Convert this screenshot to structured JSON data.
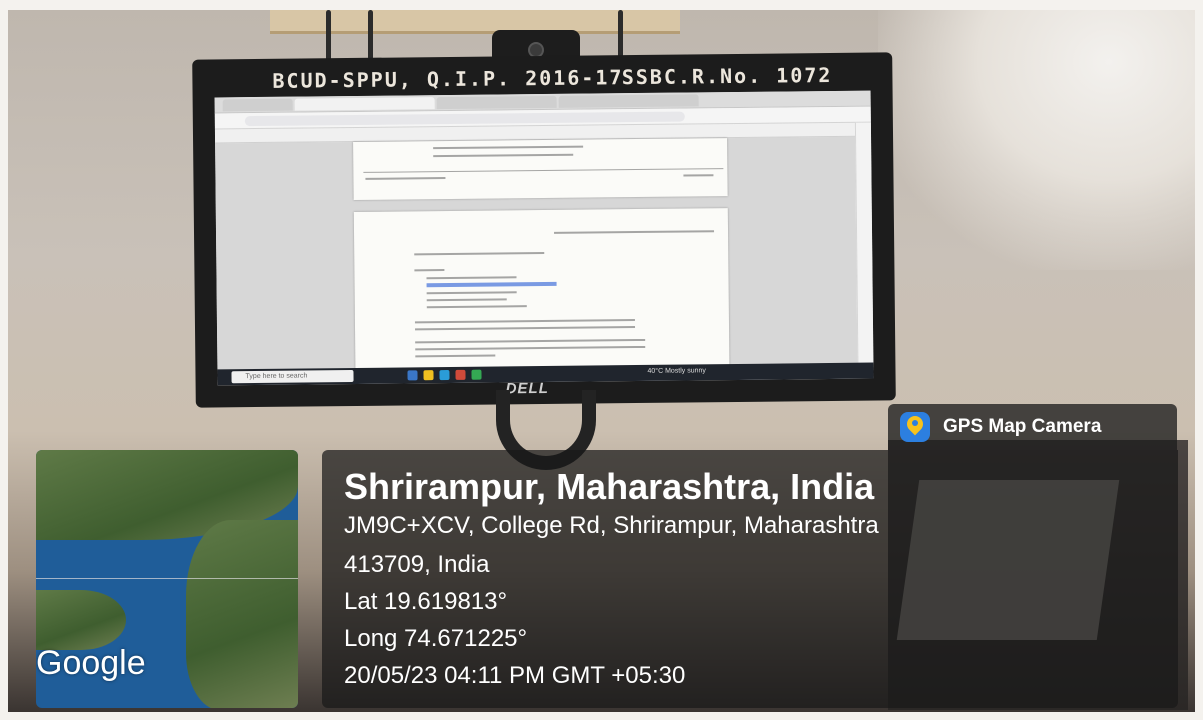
{
  "photo": {
    "monitor_sticker_left": "BCUD-SPPU, Q.I.P. 2016-17",
    "monitor_sticker_right": "SSBC.R.No. 1072",
    "monitor_brand": "DELL"
  },
  "overlay": {
    "app_badge": "GPS Map Camera",
    "location_title": "Shrirampur, Maharashtra, India",
    "address_line1": "JM9C+XCV, College Rd, Shrirampur, Maharashtra",
    "address_line2": "413709, India",
    "latitude": "Lat 19.619813°",
    "longitude": "Long 74.671225°",
    "timestamp": "20/05/23 04:11 PM GMT +05:30",
    "map_attribution": "Google"
  },
  "screen": {
    "taskbar_search_placeholder": "Type here to search",
    "weather": "40°C Mostly sunny"
  },
  "colors": {
    "overlay_bg": "#191919",
    "badge_icon": "#2c7fe0",
    "pin": "#f6c21c"
  }
}
